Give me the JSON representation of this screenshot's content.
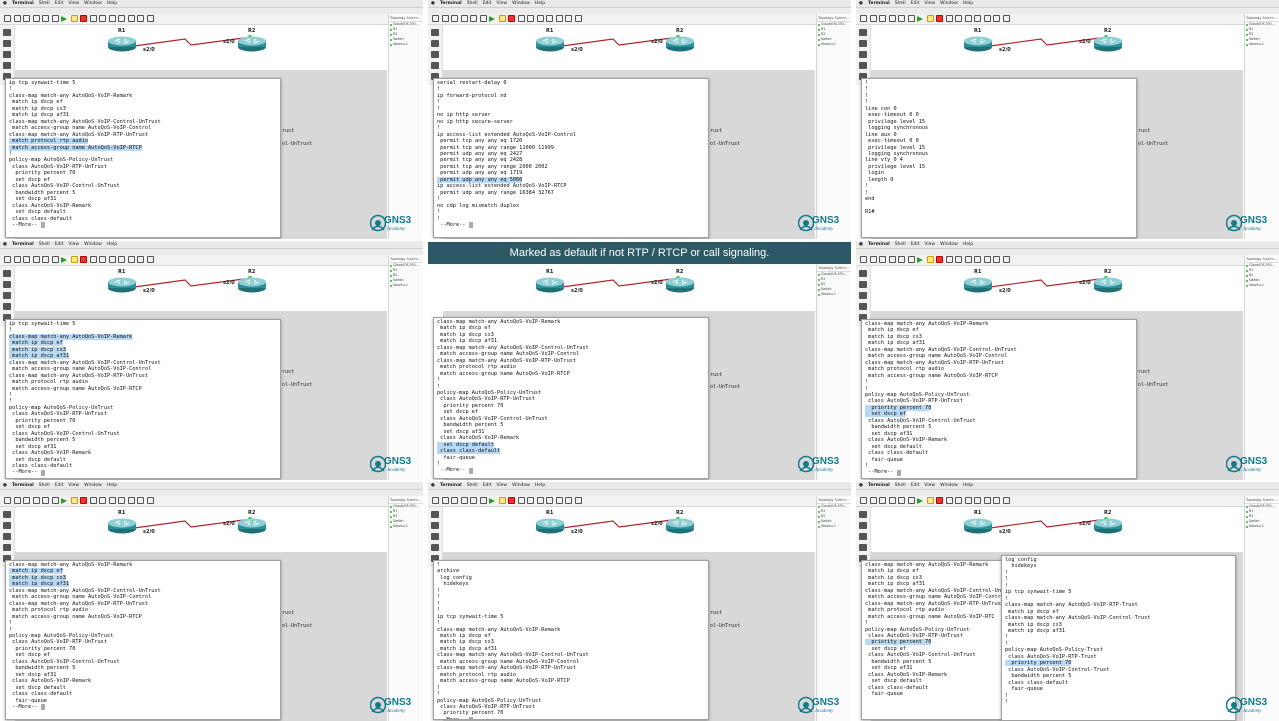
{
  "menu": [
    "Terminal",
    "Shell",
    "Edit",
    "View",
    "Window",
    "Help"
  ],
  "window_title": "gns3 - t0 - telnet 172.16.252.1 2000 - 79x24",
  "topology_panel": {
    "title": "Topology Summ...",
    "items": [
      "Cloud/iOS-5?0...",
      "R1",
      "R2",
      "Switch",
      "Ubuntu-1"
    ]
  },
  "routers": {
    "r1": "R1",
    "r2": "R2"
  },
  "links": {
    "r1_port": "s2/0",
    "r2_port": "s2/0"
  },
  "logo": {
    "name": "GNS3",
    "sub": "Academy"
  },
  "caption": "Marked  as default if not RTP / RTCP or call signaling.",
  "bg_text": [
    "rust",
    "ol-UnTrust"
  ],
  "colors": {
    "highlight": "#b9d8f3",
    "link": "#b0242c",
    "router": "#2c8e97",
    "banner": "#2b5966"
  },
  "tiles": [
    {
      "lines": [
        "ip tcp synwait-time 5",
        "!",
        "class-map match-any AutoQoS-VoIP-Remark",
        " match ip dscp ef",
        " match ip dscp cs3",
        " match ip dscp af31",
        "class-map match-any AutoQoS-VoIP-Control-UnTrust",
        " match access-group name AutoQoS-VoIP-Control",
        "class-map match-any AutoQoS-VoIP-RTP-UnTrust",
        " match protocol rtp audio",
        " match access-group name AutoQoS-VoIP-RTCP",
        "!",
        "policy-map AutoQoS-Policy-UnTrust",
        " class AutoQoS-VoIP-RTP-UnTrust",
        "  priority percent 70",
        "  set dscp ef",
        " class AutoQoS-VoIP-Control-UnTrust",
        "  bandwidth percent 5",
        "  set dscp af31",
        " class AutoQoS-VoIP-Remark",
        "  set dscp default",
        " class class-default",
        " --More-- "
      ],
      "hl": []
    },
    {
      "lines": [
        "serial restart-delay 0",
        "!",
        "ip forward-protocol nd",
        "!",
        "!",
        "no ip http server",
        "no ip http secure-server",
        "!",
        "ip access-list extended AutoQoS-VoIP-Control",
        " permit tcp any any eq 1720",
        " permit tcp any any range 11000 11999",
        " permit udp any any eq 2427",
        " permit tcp any any eq 2428",
        " permit tcp any any range 2000 2002",
        " permit udp any any eq 1719",
        " permit udp any any eq 5060",
        "ip access-list extended AutoQoS-VoIP-RTCP",
        " permit udp any any range 16384 32767",
        "!",
        "no cdp log mismatch duplex",
        "!",
        "!",
        " --More-- "
      ],
      "hl": []
    },
    {
      "lines": [
        "!",
        "!",
        "!",
        "!",
        "line con 0",
        " exec-timeout 0 0",
        " privilege level 15",
        " logging synchronous",
        "line aux 0",
        " exec-timeout 0 0",
        " privilege level 15",
        " logging synchronous",
        "line vty 0 4",
        " privilege level 15",
        " login",
        " length 0",
        "!",
        "!",
        "end",
        "",
        "R1#"
      ],
      "hl": []
    },
    {
      "lines": [
        "ip tcp synwait-time 5",
        "!",
        "class-map match-any AutoQoS-VoIP-Remark",
        " match ip dscp ef",
        " match ip dscp cs3",
        " match ip dscp af31",
        "class-map match-any AutoQoS-VoIP-Control-UnTrust",
        " match access-group name AutoQoS-VoIP-Control",
        "class-map match-any AutoQoS-VoIP-RTP-UnTrust",
        " match protocol rtp audio",
        " match access-group name AutoQoS-VoIP-RTCP",
        "!",
        "!",
        "policy-map AutoQoS-Policy-UnTrust",
        " class AutoQoS-VoIP-RTP-UnTrust",
        "  priority percent 70",
        "  set dscp ef",
        " class AutoQoS-VoIP-Control-UnTrust",
        "  bandwidth percent 5",
        "  set dscp af31",
        " class AutoQoS-VoIP-Remark",
        "  set dscp default",
        " class class-default",
        " --More-- "
      ],
      "hl": []
    },
    {
      "lines": [
        "class-map match-any AutoQoS-VoIP-Remark",
        " match ip dscp ef",
        " match ip dscp cs3",
        " match ip dscp af31",
        "class-map match-any AutoQoS-VoIP-Control-UnTrust",
        " match access-group name AutoQoS-VoIP-Control",
        "class-map match-any AutoQoS-VoIP-RTP-UnTrust",
        " match protocol rtp audio",
        " match access-group name AutoQoS-VoIP-RTCP",
        "!",
        "!",
        "policy-map AutoQoS-Policy-UnTrust",
        " class AutoQoS-VoIP-RTP-UnTrust",
        "  priority percent 70",
        "  set dscp ef",
        " class AutoQoS-VoIP-Control-UnTrust",
        "  bandwidth percent 5",
        "  set dscp af31",
        " class AutoQoS-VoIP-Remark",
        "  set dscp default",
        " class class-default",
        "  fair-queue",
        "!",
        " --More-- "
      ],
      "hl": []
    },
    {
      "lines": [
        "class-map match-any AutoQoS-VoIP-Remark",
        " match ip dscp ef",
        " match ip dscp cs3",
        " match ip dscp af31",
        "class-map match-any AutoQoS-VoIP-Control-UnTrust",
        " match access-group name AutoQoS-VoIP-Control",
        "class-map match-any AutoQoS-VoIP-RTP-UnTrust",
        " match protocol rtp audio",
        " match access-group name AutoQoS-VoIP-RTCP",
        "!",
        "!",
        "policy-map AutoQoS-Policy-UnTrust",
        " class AutoQoS-VoIP-RTP-UnTrust",
        "  priority percent 70",
        "  set dscp ef",
        " class AutoQoS-VoIP-Control-UnTrust",
        "  bandwidth percent 5",
        "  set dscp af31",
        " class AutoQoS-VoIP-Remark",
        "  set dscp default",
        " class class-default",
        "  fair-queue",
        "!",
        " --More-- "
      ],
      "hl": []
    },
    {
      "lines": [
        "class-map match-any AutoQoS-VoIP-Remark",
        " match ip dscp ef",
        " match ip dscp cs3",
        " match ip dscp af31",
        "class-map match-any AutoQoS-VoIP-Control-UnTrust",
        " match access-group name AutoQoS-VoIP-Control",
        "class-map match-any AutoQoS-VoIP-RTP-UnTrust",
        " match protocol rtp audio",
        " match access-group name AutoQoS-VoIP-RTCP",
        "!",
        "!",
        "policy-map AutoQoS-Policy-UnTrust",
        " class AutoQoS-VoIP-RTP-UnTrust",
        "  priority percent 70",
        "  set dscp ef",
        " class AutoQoS-VoIP-Control-UnTrust",
        "  bandwidth percent 5",
        "  set dscp af31",
        " class AutoQoS-VoIP-Remark",
        "  set dscp default",
        " class class-default",
        "  fair-queue",
        " --More-- "
      ],
      "hl": []
    },
    {
      "lines": [
        "!",
        "archive",
        " log config",
        "  hidekeys",
        "!",
        "!",
        "!",
        "!",
        "ip tcp synwait-time 5",
        "!",
        "class-map match-any AutoQoS-VoIP-Remark",
        " match ip dscp ef",
        " match ip dscp cs3",
        " match ip dscp af31",
        "class-map match-any AutoQoS-VoIP-Control-UnTrust",
        " match access-group name AutoQoS-VoIP-Control",
        "class-map match-any AutoQoS-VoIP-RTP-UnTrust",
        " match protocol rtp audio",
        " match access-group name AutoQoS-VoIP-RTCP",
        "!",
        "!",
        "policy-map AutoQoS-Policy-UnTrust",
        " class AutoQoS-VoIP-RTP-UnTrust",
        "  priority percent 70",
        " --More-- "
      ],
      "hl": []
    },
    {
      "lines": [
        "class-map match-any AutoQoS-VoIP-Remark",
        " match ip dscp ef",
        " match ip dscp cs3",
        " match ip dscp af31",
        "class-map match-any AutoQoS-VoIP-Control-UnTru",
        " match access-group name AutoQoS-VoIP-Contr",
        "class-map match-any AutoQoS-VoIP-RTP-UnTrus",
        " match protocol rtp audio",
        " match access-group name AutoQoS-VoIP-RTC",
        "!",
        "policy-map AutoQoS-Policy-UnTrust",
        " class AutoQoS-VoIP-RTP-UnTrust",
        "  priority percent 70",
        "  set dscp ef",
        " class AutoQoS-VoIP-Control-UnTrust",
        "  bandwidth percent 5",
        "  set dscp af31",
        " class AutoQoS-VoIP-Remark",
        "  set dscp default",
        " class class-default",
        "  fair-queue"
      ],
      "hl": []
    }
  ],
  "tile9_front": [
    "log config",
    "  hidekeys",
    "!",
    "!",
    "!",
    "ip tcp synwait-time 5",
    "!",
    "class-map match-any AutoQoS-VoIP-RTP-Trust",
    " match ip dscp ef",
    "class-map match-any AutoQoS-VoIP-Control-Trust",
    " match ip dscp cs3",
    " match ip dscp af31",
    "!",
    "!",
    "policy-map AutoQoS-Policy-Trust",
    " class AutoQoS-VoIP-RTP-Trust",
    "  priority percent 70",
    " class AutoQoS-VoIP-Control-Trust",
    "  bandwidth percent 5",
    " class class-default",
    "  fair-queue",
    "!",
    "!"
  ]
}
